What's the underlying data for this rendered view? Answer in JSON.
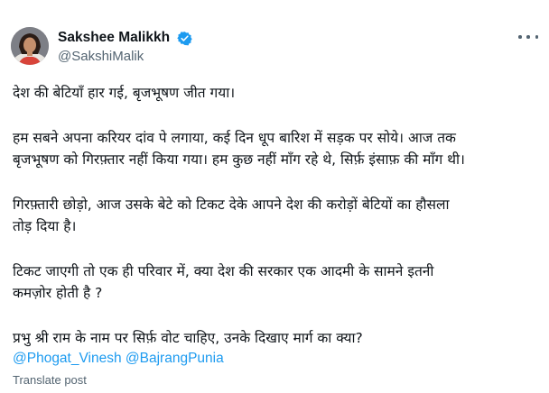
{
  "author": {
    "name": "Sakshee Malikkh",
    "handle": "@SakshiMalik",
    "verified_color": "#1d9bf0"
  },
  "tweet": {
    "lines": [
      "देश की बेटियाँ हार गई, बृजभूषण जीत गया।",
      "हम सबने अपना करियर दांव पे लगाया, कई दिन धूप बारिश में सड़क पर सोये। आज तक",
      "बृजभूषण को गिरफ़्तार नहीं किया गया। हम कुछ नहीं माँग रहे थे, सिर्फ़ इंसाफ़ की माँग थी।",
      "गिरफ़्तारी छोड़ो, आज उसके बेटे को टिकट देके आपने देश की करोड़ों बेटियों का हौसला",
      "तोड़ दिया है।",
      "टिकट जाएगी तो एक ही परिवार में, क्या देश की सरकार एक आदमी के सामने इतनी",
      "कमज़ोर होती है ?",
      "प्रभु श्री राम के नाम पर सिर्फ़ वोट चाहिए, उनके दिखाए मार्ग का क्या?"
    ],
    "mentions": [
      "@Phogat_Vinesh",
      "@BajrangPunia"
    ],
    "translate_label": "Translate post"
  },
  "icons": {
    "more": "more-options-icon",
    "verified": "verified-badge-icon",
    "avatar": "profile-photo"
  },
  "colors": {
    "link": "#1d9bf0",
    "secondary_text": "#536471",
    "primary_text": "#0f1419"
  }
}
